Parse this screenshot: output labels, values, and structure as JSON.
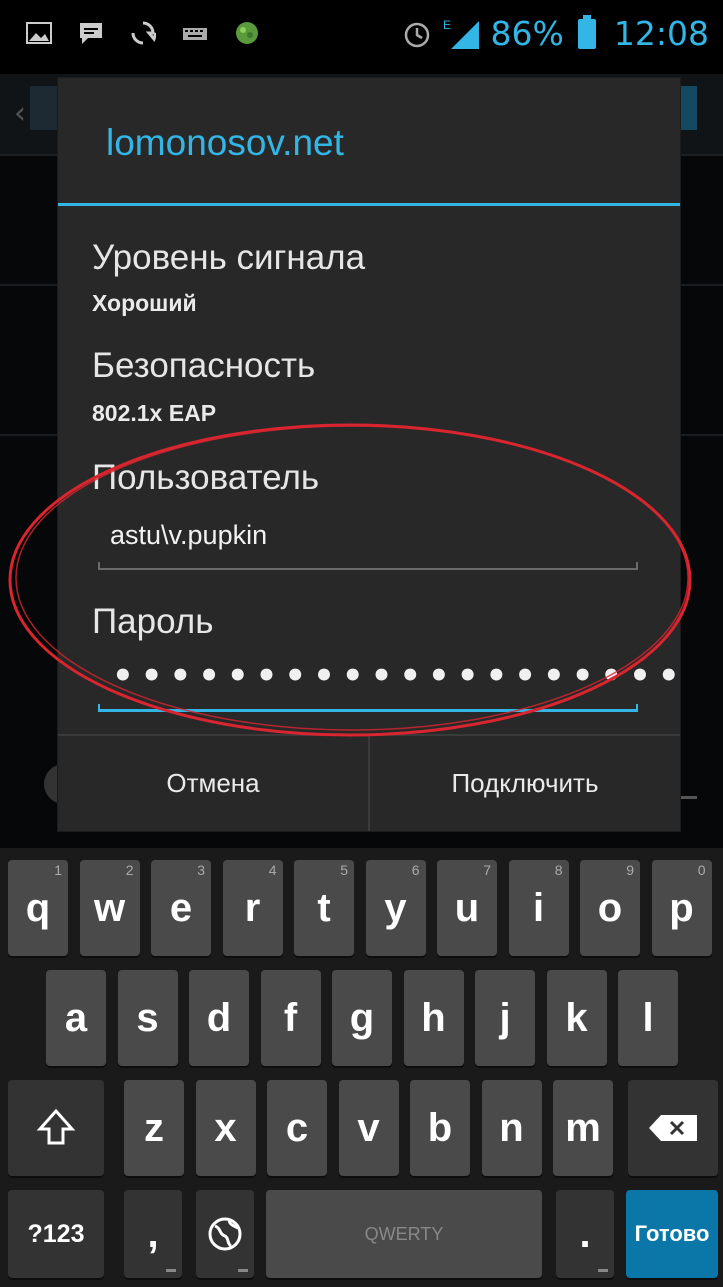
{
  "status_bar": {
    "battery_percent": "86%",
    "time": "12:08",
    "network_type": "E",
    "icons_left": [
      "image-icon",
      "message-icon",
      "sync-icon",
      "keyboard-icon",
      "app-icon"
    ],
    "accent_color": "#33b5e5"
  },
  "dialog": {
    "title": "lomonosov.net",
    "signal_label": "Уровень сигнала",
    "signal_value": "Хороший",
    "security_label": "Безопасность",
    "security_value": "802.1x EAP",
    "user_label": "Пользователь",
    "user_value": "astu\\v.pupkin",
    "password_label": "Пароль",
    "password_masked": "••••••••••••••••••••",
    "cancel_label": "Отмена",
    "connect_label": "Подключить"
  },
  "keyboard": {
    "row1": [
      {
        "key": "q",
        "hint": "1"
      },
      {
        "key": "w",
        "hint": "2"
      },
      {
        "key": "e",
        "hint": "3"
      },
      {
        "key": "r",
        "hint": "4"
      },
      {
        "key": "t",
        "hint": "5"
      },
      {
        "key": "y",
        "hint": "6"
      },
      {
        "key": "u",
        "hint": "7"
      },
      {
        "key": "i",
        "hint": "8"
      },
      {
        "key": "o",
        "hint": "9"
      },
      {
        "key": "p",
        "hint": "0"
      }
    ],
    "row2": [
      "a",
      "s",
      "d",
      "f",
      "g",
      "h",
      "j",
      "k",
      "l"
    ],
    "row3": [
      "z",
      "x",
      "c",
      "v",
      "b",
      "n",
      "m"
    ],
    "symbols_label": "?123",
    "comma_label": ",",
    "space_label": "QWERTY",
    "period_label": ".",
    "done_label": "Готово"
  }
}
